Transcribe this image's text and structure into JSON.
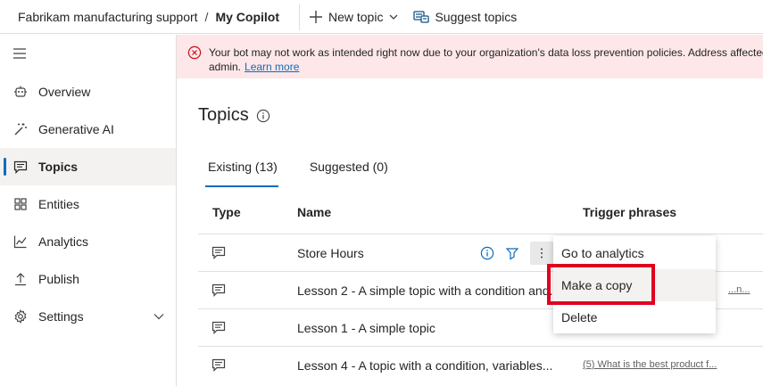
{
  "breadcrumb": {
    "parent": "Fabrikam manufacturing support",
    "separator": "/",
    "current": "My Copilot"
  },
  "toolbar": {
    "new_topic": "New topic",
    "suggest_topics": "Suggest topics"
  },
  "sidebar": {
    "items": [
      {
        "label": "Overview",
        "icon": "robot-icon"
      },
      {
        "label": "Generative AI",
        "icon": "magic-wand-icon"
      },
      {
        "label": "Topics",
        "icon": "chat-icon",
        "active": true
      },
      {
        "label": "Entities",
        "icon": "entities-icon"
      },
      {
        "label": "Analytics",
        "icon": "analytics-icon"
      },
      {
        "label": "Publish",
        "icon": "upload-icon"
      },
      {
        "label": "Settings",
        "icon": "gear-icon"
      }
    ]
  },
  "banner": {
    "message": "Your bot may not work as intended right now due to your organization's data loss prevention policies. Address affected",
    "message_line2": "admin.",
    "link": "Learn more",
    "color": "#fde7e9"
  },
  "page": {
    "title": "Topics"
  },
  "tabs": [
    {
      "label": "Existing (13)",
      "active": true
    },
    {
      "label": "Suggested (0)"
    }
  ],
  "table": {
    "headers": {
      "type": "Type",
      "name": "Name",
      "trigger": "Trigger phrases"
    },
    "rows": [
      {
        "name": "Store Hours",
        "trigger": "?"
      },
      {
        "name": "Lesson 2 - A simple topic with a condition and...",
        "trigger": "...n..."
      },
      {
        "name": "Lesson 1 - A simple topic",
        "trigger": ""
      },
      {
        "name": "Lesson 4 - A topic with a condition, variables...",
        "trigger": "(5) What is the best product f..."
      }
    ]
  },
  "context_menu": {
    "items": [
      "Go to analytics",
      "Make a copy",
      "Delete"
    ],
    "highlighted": "Make a copy"
  },
  "colors": {
    "accent": "#0f6cbd",
    "error": "#c50f1f",
    "annotation": "#e00020"
  }
}
